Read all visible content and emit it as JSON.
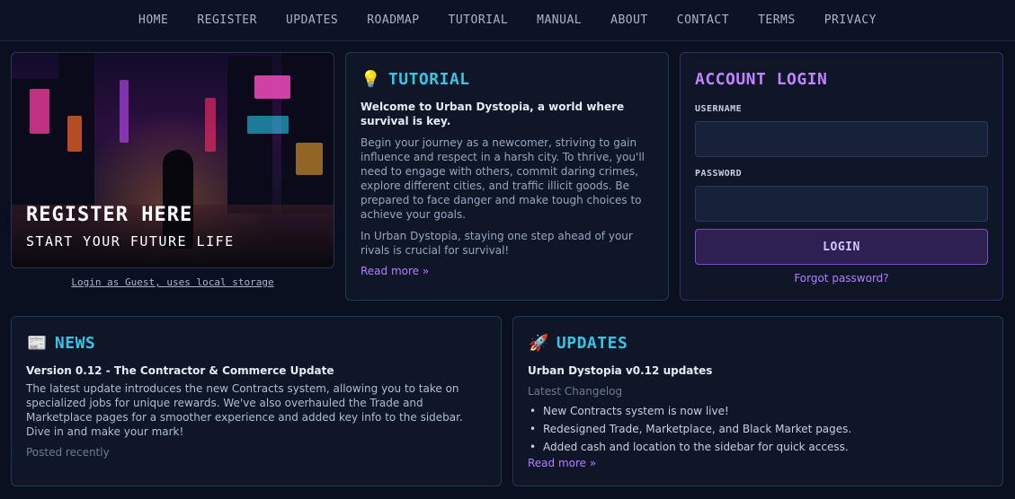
{
  "nav": [
    "HOME",
    "REGISTER",
    "UPDATES",
    "ROADMAP",
    "TUTORIAL",
    "MANUAL",
    "ABOUT",
    "CONTACT",
    "TERMS",
    "PRIVACY"
  ],
  "hero": {
    "title": "REGISTER HERE",
    "subtitle": "START YOUR FUTURE LIFE",
    "guest_link": "Login as Guest, uses local storage"
  },
  "tutorial": {
    "icon": "lightbulb-icon",
    "title": "TUTORIAL",
    "lead": "Welcome to Urban Dystopia, a world where survival is key.",
    "p1": "Begin your journey as a newcomer, striving to gain influence and respect in a harsh city. To thrive, you'll need to engage with others, commit daring crimes, explore different cities, and traffic illicit goods. Be prepared to face danger and make tough choices to achieve your goals.",
    "p2": "In Urban Dystopia, staying one step ahead of your rivals is crucial for survival!",
    "more": "Read more »"
  },
  "login": {
    "title": "ACCOUNT LOGIN",
    "username_label": "USERNAME",
    "password_label": "PASSWORD",
    "username_value": "",
    "password_value": "",
    "button": "LOGIN",
    "forgot": "Forgot password?"
  },
  "news": {
    "icon": "newspaper-icon",
    "title": "NEWS",
    "headline": "Version 0.12 - The Contractor & Commerce Update",
    "body": "The latest update introduces the new Contracts system, allowing you to take on specialized jobs for unique rewards. We've also overhauled the Trade and Marketplace pages for a smoother experience and added key info to the sidebar. Dive in and make your mark!",
    "posted": "Posted recently"
  },
  "updates": {
    "icon": "rocket-icon",
    "title": "UPDATES",
    "headline": "Urban Dystopia v0.12 updates",
    "changelog_label": "Latest Changelog",
    "items": [
      "New Contracts system is now live!",
      "Redesigned Trade, Marketplace, and Black Market pages.",
      "Added cash and location to the sidebar for quick access."
    ],
    "more": "Read more »"
  },
  "colors": {
    "accent_cyan": "#35c6e6",
    "accent_purple": "#c084fc",
    "link_purple": "#b57cff",
    "background": "#0b1020"
  }
}
